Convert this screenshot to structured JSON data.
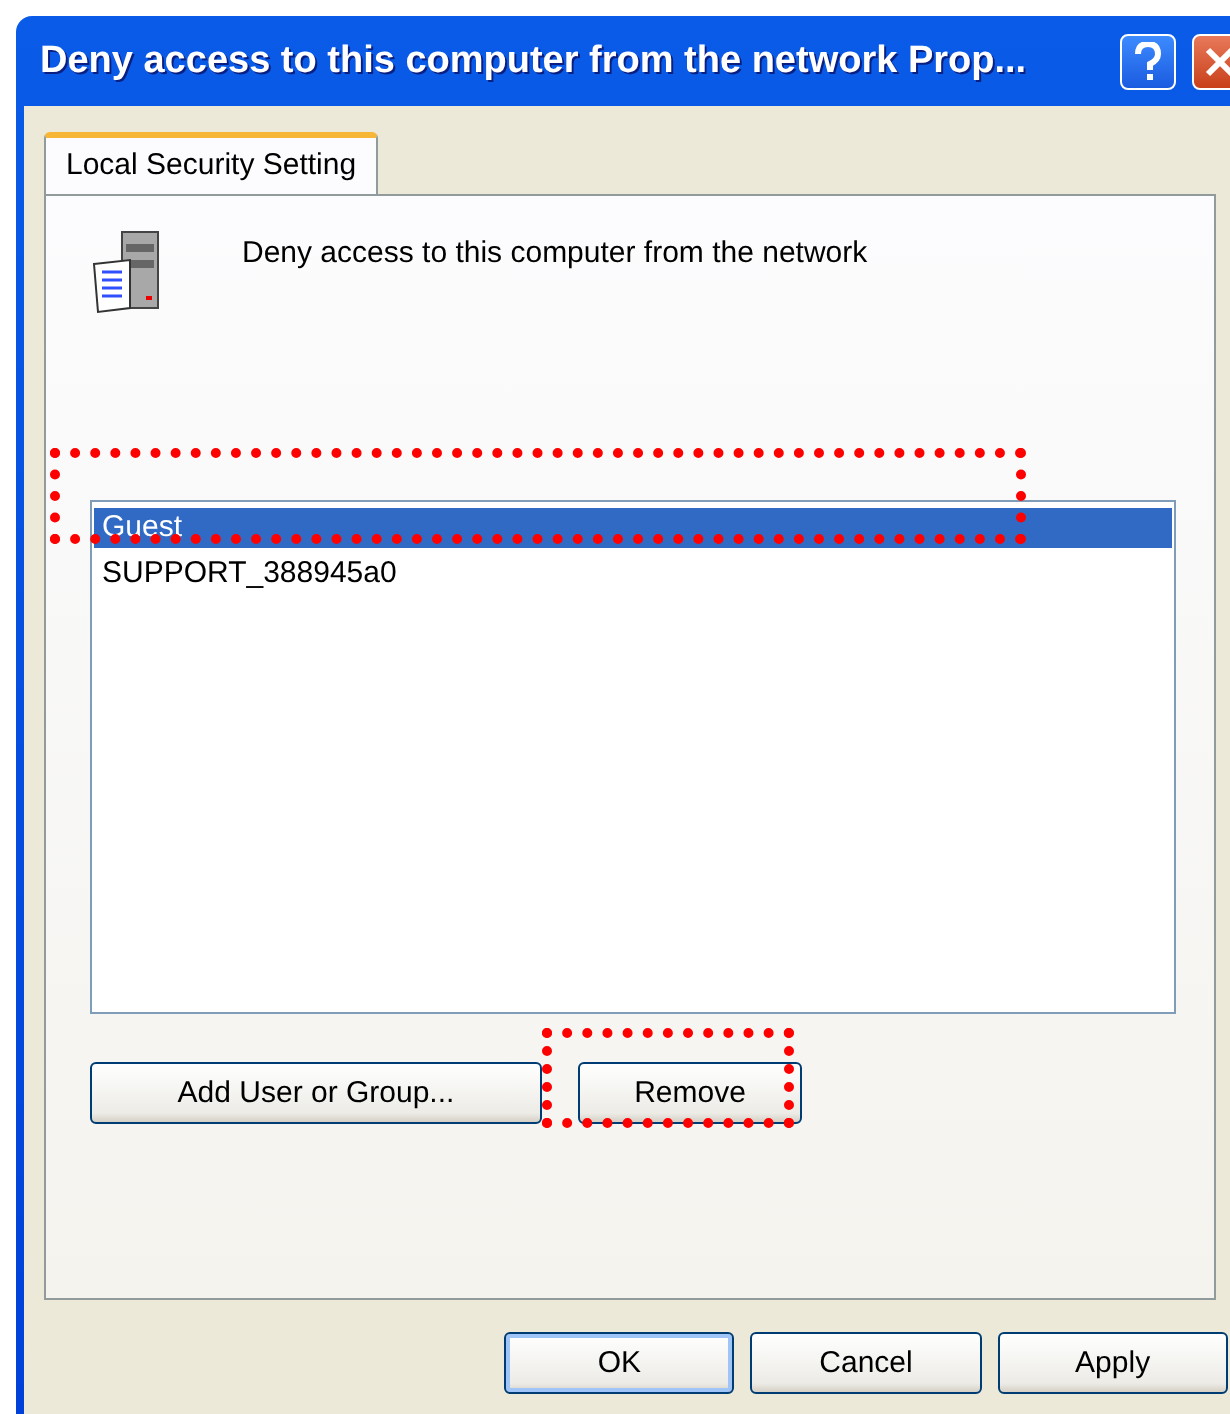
{
  "window": {
    "title": "Deny access to this computer from the network Prop..."
  },
  "tabs": [
    {
      "label": "Local Security Setting",
      "selected": true
    }
  ],
  "policy": {
    "name": "Deny access to this computer from the network"
  },
  "list": {
    "marked": true,
    "items": [
      {
        "label": "Guest",
        "selected": true
      },
      {
        "label": "SUPPORT_388945a0",
        "selected": false
      }
    ]
  },
  "actions": [
    {
      "label": "Add User or Group...",
      "marked": false
    },
    {
      "label": "Remove",
      "marked": true
    }
  ],
  "buttons": [
    {
      "label": "OK",
      "default": true
    },
    {
      "label": "Cancel",
      "default": false
    },
    {
      "label": "Apply",
      "default": false
    }
  ]
}
